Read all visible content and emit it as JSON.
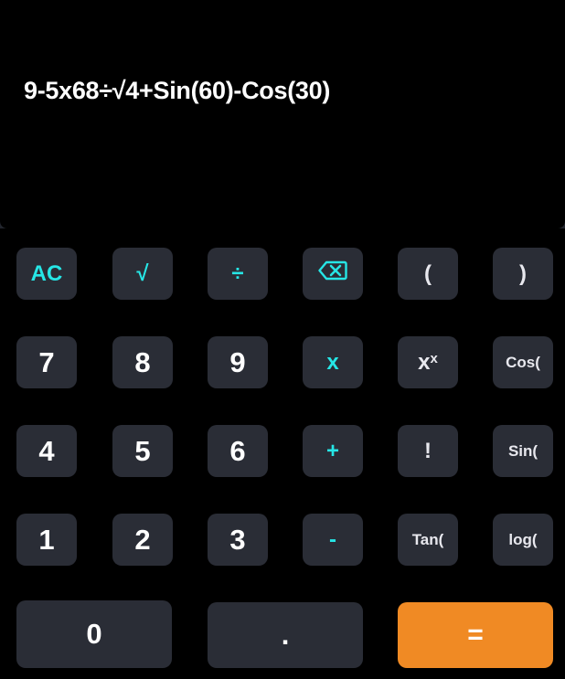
{
  "display": {
    "expression": "9-5x68÷√4+Sin(60)-Cos(30)"
  },
  "colors": {
    "background": "#000000",
    "key_bg": "#2a2d36",
    "operator_accent": "#26e6e6",
    "equals_bg": "#f08a24",
    "text": "#ffffff"
  },
  "keys": {
    "ac": "AC",
    "sqrt": "√",
    "divide": "÷",
    "backspace_icon": "backspace-icon",
    "open_paren": "(",
    "close_paren": ")",
    "seven": "7",
    "eight": "8",
    "nine": "9",
    "multiply": "x",
    "power_base": "x",
    "power_exp": "x",
    "cos": "Cos(",
    "four": "4",
    "five": "5",
    "six": "6",
    "plus": "+",
    "factorial": "!",
    "sin": "Sin(",
    "one": "1",
    "two": "2",
    "three": "3",
    "minus": "-",
    "tan": "Tan(",
    "log": "log(",
    "zero": "0",
    "decimal": ".",
    "equals": "="
  }
}
